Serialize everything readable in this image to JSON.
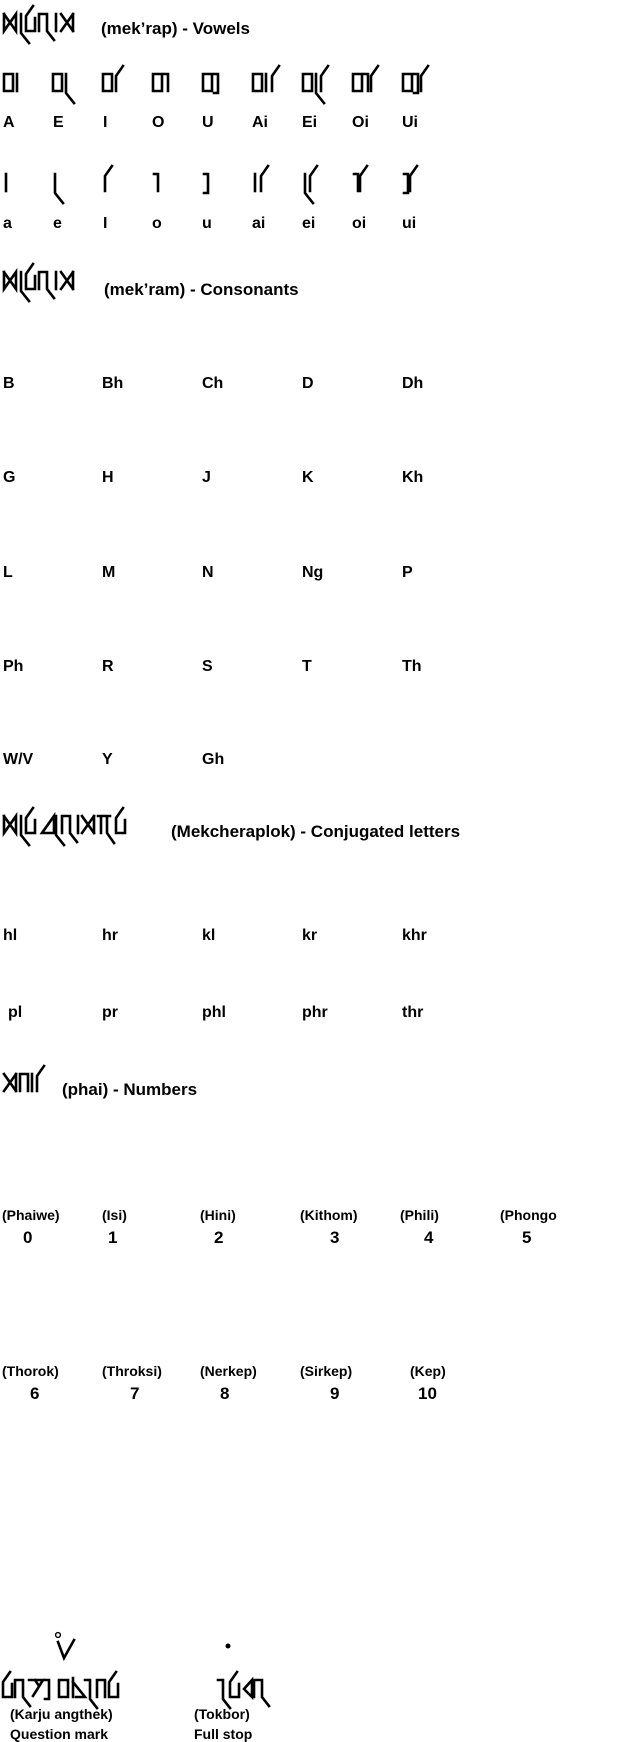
{
  "sections": {
    "vowels": {
      "heading": "(mek’rap) - Vowels",
      "script_title_icon": "mekrap-script-glyph",
      "independent": [
        "A",
        "E",
        "I",
        "O",
        "U",
        "Ai",
        "Ei",
        "Oi",
        "Ui"
      ],
      "dependent": [
        "a",
        "e",
        "I",
        "o",
        "u",
        "ai",
        "ei",
        "oi",
        "ui"
      ]
    },
    "consonants": {
      "heading": "(mek’ram) - Consonants",
      "script_title_icon": "mekram-script-glyph",
      "rows": [
        [
          "B",
          "Bh",
          "Ch",
          "D",
          "Dh"
        ],
        [
          "G",
          "H",
          "J",
          "K",
          "Kh"
        ],
        [
          "L",
          "M",
          "N",
          "Ng",
          "P"
        ],
        [
          "Ph",
          "R",
          "S",
          "T",
          "Th"
        ],
        [
          "W/V",
          "Y",
          "Gh"
        ]
      ]
    },
    "conjugated": {
      "heading": "(Mekcheraplok) - Conjugated letters",
      "script_title_icon": "mekcheraplok-script-glyph",
      "rows": [
        [
          "hl",
          "hr",
          "kl",
          "kr",
          "khr"
        ],
        [
          "pl",
          "pr",
          "phl",
          "phr",
          "thr"
        ]
      ]
    },
    "numbers": {
      "heading": "(phai) - Numbers",
      "script_title_icon": "phai-script-glyph",
      "row1": [
        {
          "name": "(Phaiwe)",
          "digit": "0"
        },
        {
          "name": "(Isi)",
          "digit": "1"
        },
        {
          "name": "(Hini)",
          "digit": "2"
        },
        {
          "name": "(Kithom)",
          "digit": "3"
        },
        {
          "name": "(Phili)",
          "digit": "4"
        },
        {
          "name": "(Phongo",
          "digit": "5"
        }
      ],
      "row2": [
        {
          "name": "(Thorok)",
          "digit": "6"
        },
        {
          "name": "(Throksi)",
          "digit": "7"
        },
        {
          "name": "(Nerkep)",
          "digit": "8"
        },
        {
          "name": "(Sirkep)",
          "digit": "9"
        },
        {
          "name": "(Kep)",
          "digit": "10"
        }
      ]
    },
    "punctuation": {
      "items": [
        {
          "name": "(Karju angthek)",
          "meaning": "Question mark"
        },
        {
          "name": "(Tokbor)",
          "meaning": "Full stop"
        }
      ]
    }
  }
}
